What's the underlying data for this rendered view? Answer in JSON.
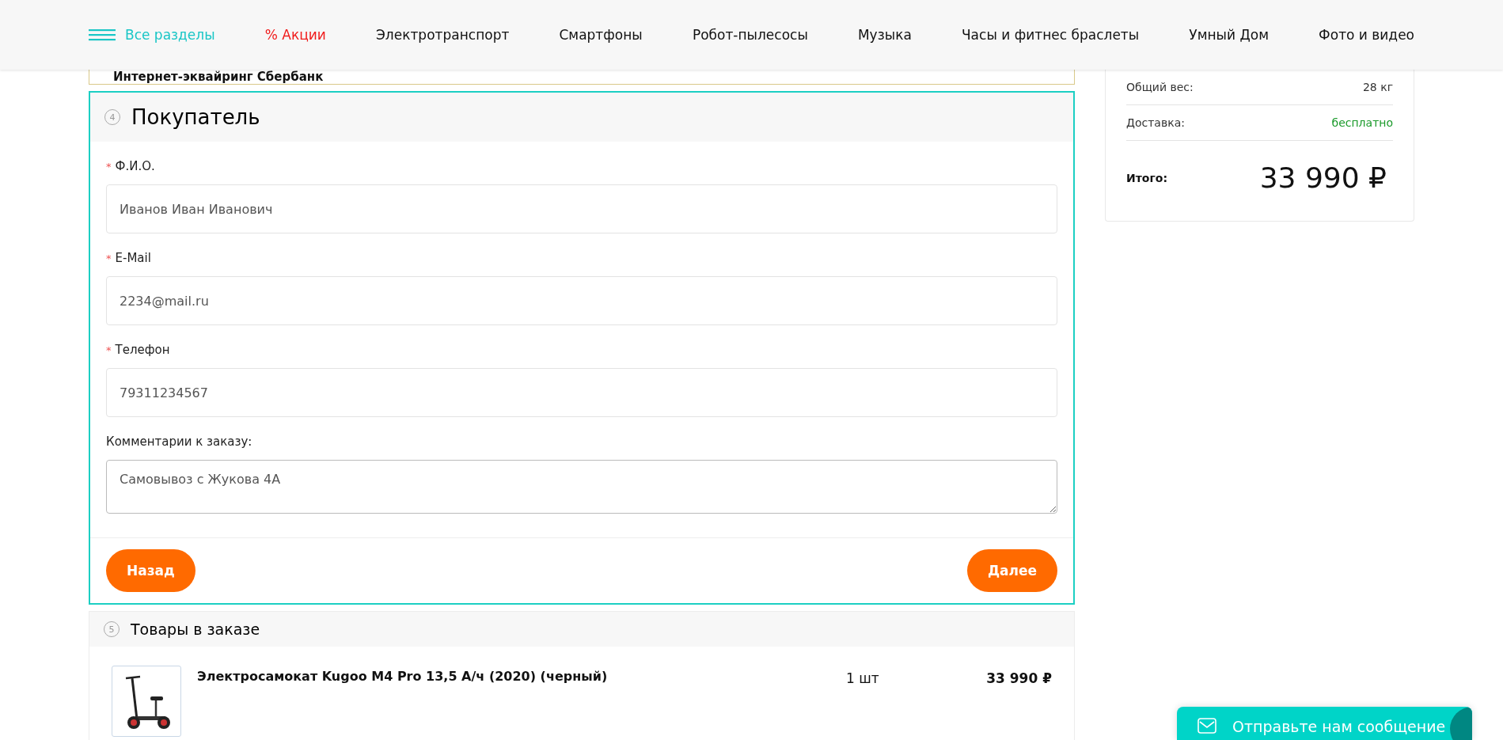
{
  "nav": {
    "all_sections": "Все разделы",
    "items": [
      {
        "label": "% Акции",
        "kind": "promo"
      },
      {
        "label": "Электротранспорт",
        "kind": "link"
      },
      {
        "label": "Смартфоны",
        "kind": "link"
      },
      {
        "label": "Робот-пылесосы",
        "kind": "link"
      },
      {
        "label": "Музыка",
        "kind": "link"
      },
      {
        "label": "Часы и фитнес браслеты",
        "kind": "link"
      },
      {
        "label": "Умный Дом",
        "kind": "link"
      },
      {
        "label": "Фото и видео",
        "kind": "link"
      }
    ]
  },
  "payment_option": {
    "label": "Интернет-эквайринг Сбербанк"
  },
  "buyer_section": {
    "number": "4",
    "title": "Покупатель",
    "required_mark": "*",
    "fields": [
      {
        "label": "Ф.И.О.",
        "required": true,
        "value": "Иванов Иван Иванович",
        "kind": "input"
      },
      {
        "label": "E-Mail",
        "required": true,
        "value": "2234@mail.ru",
        "kind": "input"
      },
      {
        "label": "Телефон",
        "required": true,
        "value": "79311234567",
        "kind": "input"
      },
      {
        "label": "Комментарии к заказу:",
        "required": false,
        "value": "Самовывоз с Жукова 4А",
        "kind": "textarea"
      }
    ],
    "back_button": "Назад",
    "next_button": "Далее"
  },
  "items_section": {
    "number": "5",
    "title": "Товары в заказе",
    "items": [
      {
        "name": "Электросамокат Kugoo M4 Pro 13,5 А/ч (2020) (черный)",
        "quantity": "1 шт",
        "price": "33 990 ₽"
      }
    ]
  },
  "summary": {
    "rows": [
      {
        "label": "Общий вес:",
        "value": "28 кг",
        "kind": "plain"
      },
      {
        "label": "Доставка:",
        "value": "бесплатно",
        "kind": "free"
      }
    ],
    "total_label": "Итого:",
    "total": "33 990 ₽"
  },
  "chat_widget": {
    "label": "Отправьте нам сообщение"
  }
}
